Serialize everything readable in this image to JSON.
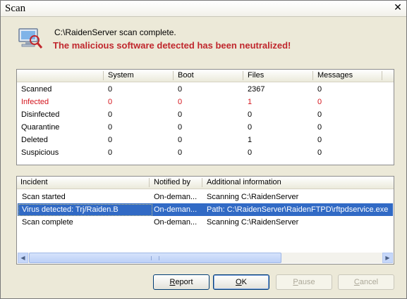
{
  "window": {
    "title": "Scan",
    "close_glyph": "✕"
  },
  "header": {
    "icon": "computer-scan-icon",
    "line1": "C:\\RaidenServer scan complete.",
    "line2": "The malicious software detected has been neutralized!"
  },
  "stats": {
    "columns": [
      "",
      "System",
      "Boot",
      "Files",
      "Messages"
    ],
    "rows": [
      {
        "label": "Scanned",
        "values": [
          "0",
          "0",
          "2367",
          "0"
        ],
        "red": false
      },
      {
        "label": "Infected",
        "values": [
          "0",
          "0",
          "1",
          "0"
        ],
        "red": true
      },
      {
        "label": "Disinfected",
        "values": [
          "0",
          "0",
          "0",
          "0"
        ],
        "red": false
      },
      {
        "label": "Quarantine",
        "values": [
          "0",
          "0",
          "0",
          "0"
        ],
        "red": false
      },
      {
        "label": "Deleted",
        "values": [
          "0",
          "0",
          "1",
          "0"
        ],
        "red": false
      },
      {
        "label": "Suspicious",
        "values": [
          "0",
          "0",
          "0",
          "0"
        ],
        "red": false
      }
    ]
  },
  "incidents": {
    "columns": [
      "Incident",
      "Notified by",
      "Additional information"
    ],
    "rows": [
      {
        "incident": "Scan started",
        "notified": "On-deman...",
        "info": "Scanning C:\\RaidenServer",
        "selected": false
      },
      {
        "incident": "Virus detected: Trj/Raiden.B",
        "notified": "On-deman...",
        "info": "Path: C:\\RaidenServer\\RaidenFTPD\\rftpdservice.exe",
        "selected": true
      },
      {
        "incident": "Scan complete",
        "notified": "On-deman...",
        "info": "Scanning C:\\RaidenServer",
        "selected": false
      }
    ]
  },
  "buttons": {
    "report": {
      "pre": "",
      "key": "R",
      "post": "eport"
    },
    "ok": {
      "pre": "",
      "key": "O",
      "post": "K"
    },
    "pause": {
      "pre": "",
      "key": "P",
      "post": "ause"
    },
    "cancel": {
      "pre": "",
      "key": "C",
      "post": "ancel"
    }
  },
  "colors": {
    "alert_red": "#c0272d",
    "selection": "#316ac5"
  }
}
